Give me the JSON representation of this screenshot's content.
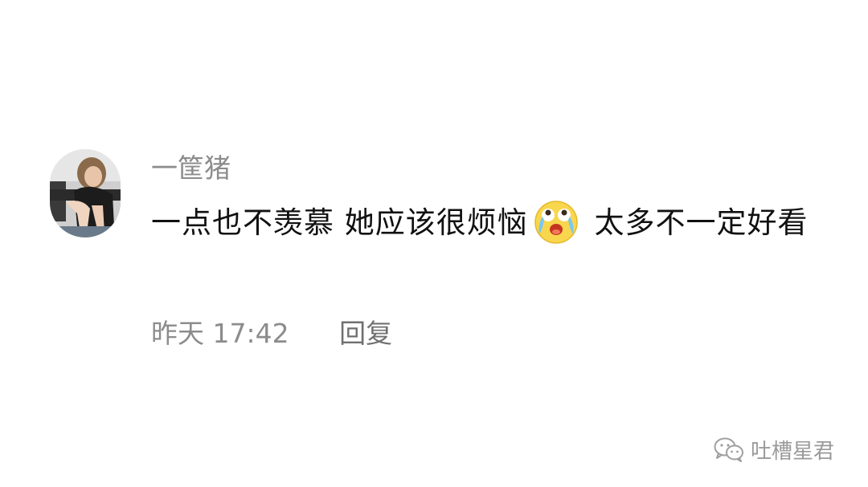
{
  "comment": {
    "username": "一筐猪",
    "text_before_emoji": "一点也不羡慕 她应该很烦恼",
    "emoji": "crying-laughing-emoji",
    "text_after_emoji": " 太多不一定好看",
    "timestamp": "昨天 17:42",
    "reply_label": "回复"
  },
  "watermark": {
    "text": "吐槽星君",
    "icon": "wechat-icon"
  }
}
